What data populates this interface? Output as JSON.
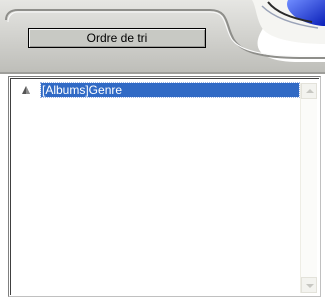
{
  "header": {
    "sort_order_label": "Ordre de tri"
  },
  "list": {
    "items": [
      {
        "label": "[Albums]Genre",
        "selected": true,
        "sort_direction": "ascending"
      }
    ]
  },
  "colors": {
    "selection": "#316ac5",
    "skin_gray": "#c8c9c4",
    "accent_blue": "#1a3fcf"
  },
  "icons": {
    "sort": "ascending-triangle-icon",
    "decor": "blue-orb-icon"
  }
}
